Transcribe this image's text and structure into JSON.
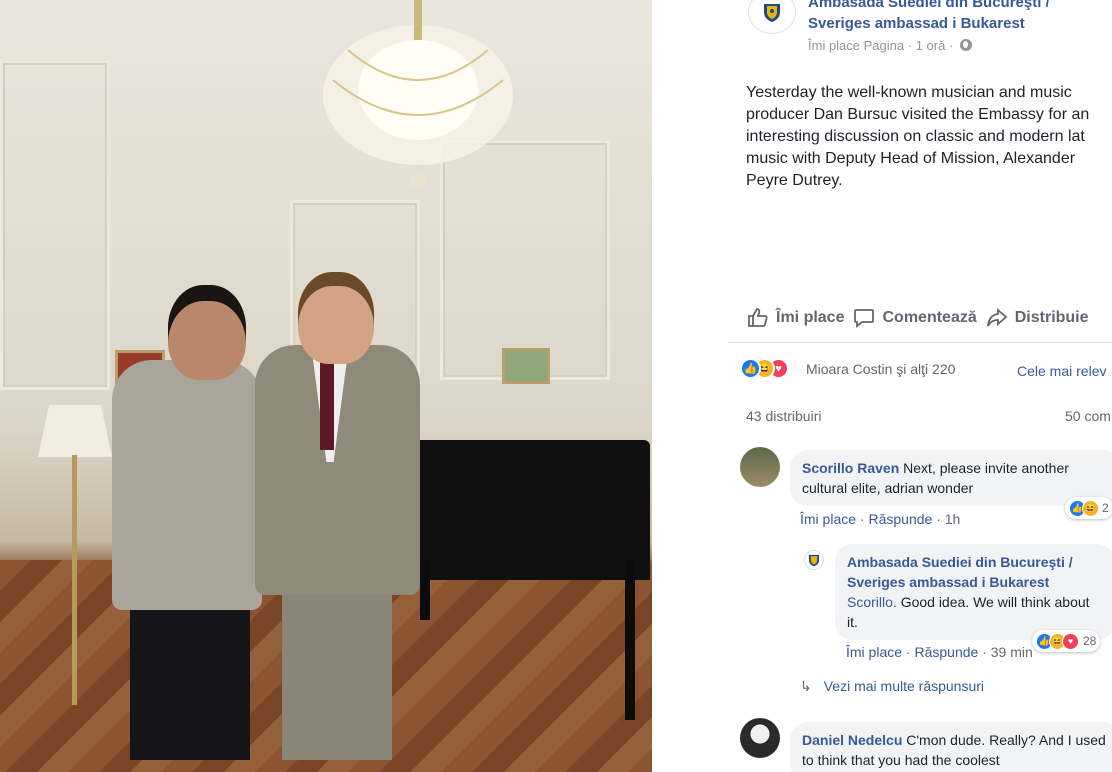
{
  "page": {
    "name": "Ambasada Suediei din Bucureşti / Sveriges ambassad i Bukarest",
    "like_page": "Îmi place Pagina",
    "time": "1 oră",
    "separator": " · "
  },
  "post": {
    "text": "Yesterday the well-known musician and music\nproducer Dan Bursuc visited the Embassy for an\ninteresting discussion on classic and modern lat\nmusic with Deputy Head of Mission, Alexander\nPeyre Dutrey."
  },
  "actions": {
    "like": "Îmi place",
    "comment": "Comentează",
    "share": "Distribuie"
  },
  "reactions": {
    "names": "Mioara Costin şi alţi 220",
    "sort": "Cele mai relev",
    "shares": "43 distribuiri",
    "comments": "50 com"
  },
  "comments": [
    {
      "author": "Scorillo Raven",
      "text": "Next, please invite another cultural elite, adrian wonder",
      "like": "Îmi place",
      "reply": "Răspunde",
      "time": "1h",
      "reaction_count": "2"
    },
    {
      "author": "Ambasada Suediei din Bucureşti / Sveriges ambassad i Bukarest",
      "mention": "Scorillo.",
      "text": "Good idea. We will think about it.",
      "like": "Îmi place",
      "reply": "Răspunde",
      "time": "39 min",
      "reaction_count": "28"
    },
    {
      "author": "Daniel Nedelcu",
      "text": "C'mon dude. Really? And I used to think that you had the coolest"
    }
  ],
  "more_replies": "Vezi mai multe răspunsuri",
  "colors": {
    "link": "#385898",
    "meta": "#90949c",
    "like_blue": "#1877f2",
    "haha_yellow": "#f7b125",
    "love_red": "#f33e58"
  }
}
